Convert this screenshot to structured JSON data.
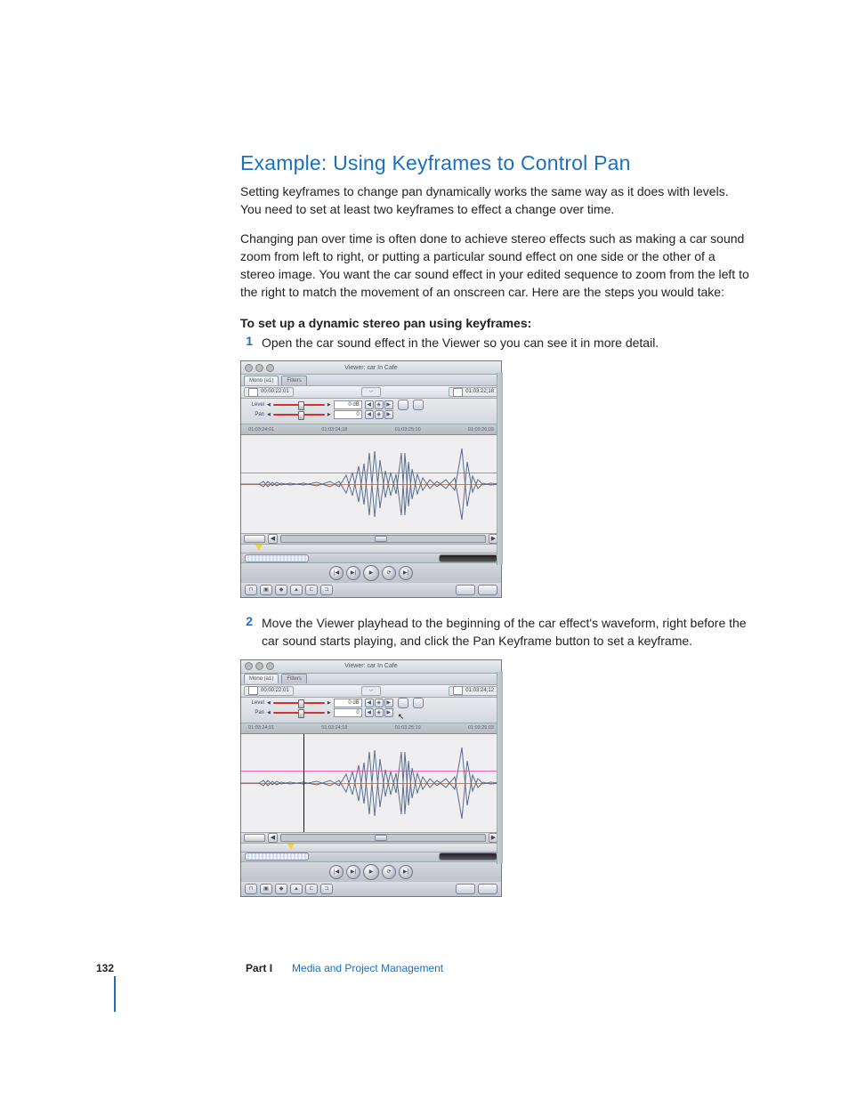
{
  "heading": "Example:  Using Keyframes to Control Pan",
  "para1": "Setting keyframes to change pan dynamically works the same way as it does with levels. You need to set at least two keyframes to effect a change over time.",
  "para2": "Changing pan over time is often done to achieve stereo effects such as making a car sound zoom from left to right, or putting a particular sound effect on one side or the other of a stereo image. You want the car sound effect in your edited sequence to zoom from the left to the right to match the movement of an onscreen car. Here are the steps you would take:",
  "task_title": "To set up a dynamic stereo pan using keyframes:",
  "steps": {
    "n1": "1",
    "t1": "Open the car sound effect in the Viewer so you can see it in more detail.",
    "n2": "2",
    "t2": "Move the Viewer playhead to the beginning of the car effect's waveform, right before the car sound starts playing, and click the Pan Keyframe button to set a keyframe."
  },
  "viewer": {
    "title": "Viewer: car In Cafe",
    "tab_mono": "Mono (a1)",
    "tab_filters": "Filters",
    "tc_left": "00:00:22:01",
    "tc_right_a": "01:03:22;18",
    "tc_right_b": "01:03:24;12",
    "level_label": "Level",
    "level_value": "0 dB",
    "pan_label": "Pan",
    "pan_value": "0",
    "ruler_t1": "01:03:24;01",
    "ruler_t2": "01:03:24;18",
    "ruler_t3": "01:03:25;10",
    "ruler_t4": "01:03:26;03"
  },
  "footer": {
    "page": "132",
    "part_label": "Part I",
    "part_name": "Media and Project Management"
  }
}
